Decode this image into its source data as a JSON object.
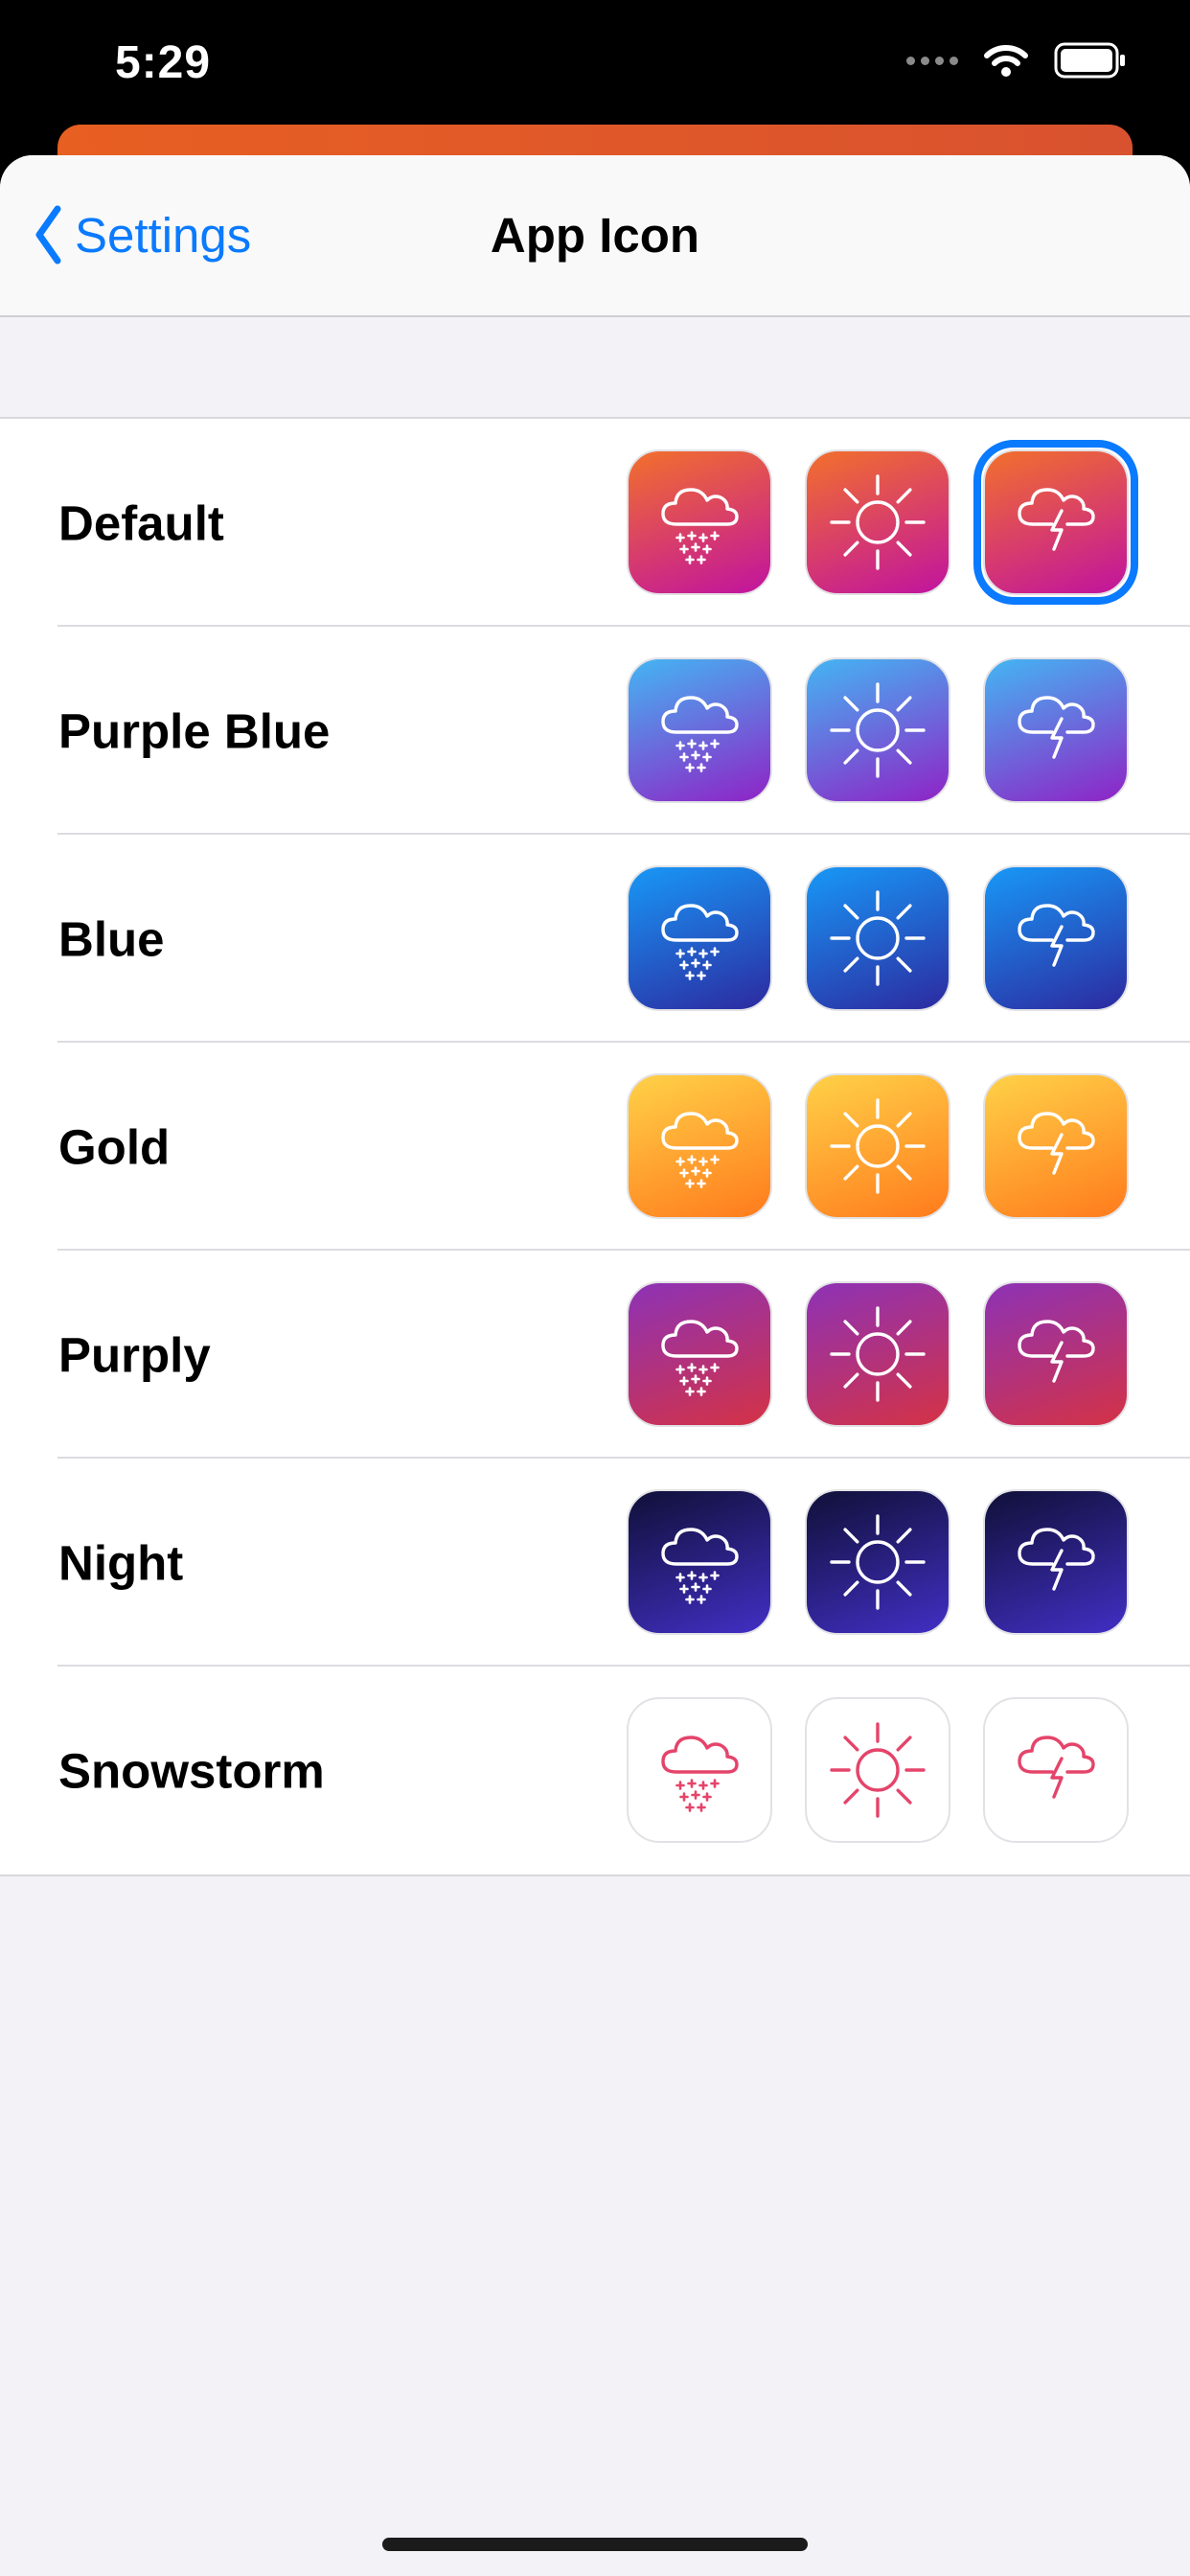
{
  "status": {
    "time": "5:29"
  },
  "nav": {
    "back_label": "Settings",
    "title": "App Icon"
  },
  "colors": {
    "accent": "#0a7aff",
    "snowstorm_stroke": "#e5446a"
  },
  "icon_types": [
    "snow-cloud-icon",
    "sun-icon",
    "thunder-cloud-icon"
  ],
  "selected": {
    "theme": "Default",
    "icon": "thunder-cloud-icon"
  },
  "themes": [
    {
      "label": "Default",
      "gradient": [
        "#f2702c",
        "#c1139f"
      ]
    },
    {
      "label": "Purple Blue",
      "gradient": [
        "#44b5f3",
        "#8f23c6"
      ]
    },
    {
      "label": "Blue",
      "gradient": [
        "#1898f7",
        "#2c2aa0"
      ]
    },
    {
      "label": "Gold",
      "gradient": [
        "#ffd148",
        "#ff7b1c"
      ]
    },
    {
      "label": "Purply",
      "gradient": [
        "#8d32b6",
        "#d43245"
      ]
    },
    {
      "label": "Night",
      "gradient": [
        "#101038",
        "#412fc4"
      ]
    },
    {
      "label": "Snowstorm",
      "gradient": [
        "#ffffff",
        "#ffffff"
      ]
    }
  ]
}
